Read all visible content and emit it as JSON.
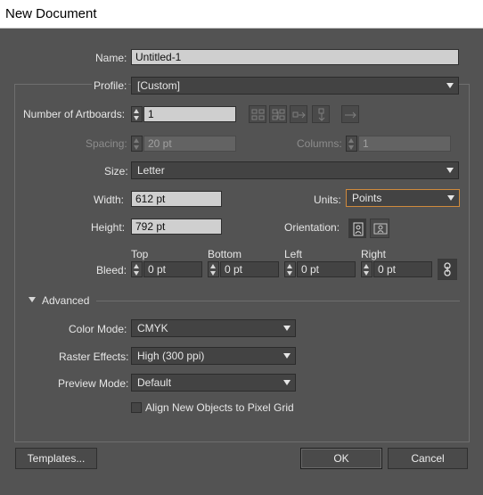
{
  "window": {
    "title": "New Document"
  },
  "name": {
    "label": "Name:",
    "value": "Untitled-1"
  },
  "profile": {
    "label": "Profile:",
    "value": "[Custom]"
  },
  "artboards": {
    "label": "Number of Artboards:",
    "value": "1"
  },
  "spacing": {
    "label": "Spacing:",
    "value": "20 pt"
  },
  "columns": {
    "label": "Columns:",
    "value": "1"
  },
  "size": {
    "label": "Size:",
    "value": "Letter"
  },
  "width": {
    "label": "Width:",
    "value": "612 pt"
  },
  "units": {
    "label": "Units:",
    "value": "Points"
  },
  "height": {
    "label": "Height:",
    "value": "792 pt"
  },
  "orientation": {
    "label": "Orientation:"
  },
  "bleed": {
    "label": "Bleed:",
    "top": {
      "label": "Top",
      "value": "0 pt"
    },
    "bottom": {
      "label": "Bottom",
      "value": "0 pt"
    },
    "left": {
      "label": "Left",
      "value": "0 pt"
    },
    "right": {
      "label": "Right",
      "value": "0 pt"
    }
  },
  "advanced": {
    "label": "Advanced",
    "color_mode": {
      "label": "Color Mode:",
      "value": "CMYK"
    },
    "raster_effects": {
      "label": "Raster Effects:",
      "value": "High (300 ppi)"
    },
    "preview_mode": {
      "label": "Preview Mode:",
      "value": "Default"
    },
    "pixel_grid": {
      "label": "Align New Objects to Pixel Grid",
      "checked": false
    }
  },
  "buttons": {
    "templates": "Templates...",
    "ok": "OK",
    "cancel": "Cancel"
  },
  "colors": {
    "dialog_bg": "#535353",
    "focus_border": "#d08a3c"
  }
}
